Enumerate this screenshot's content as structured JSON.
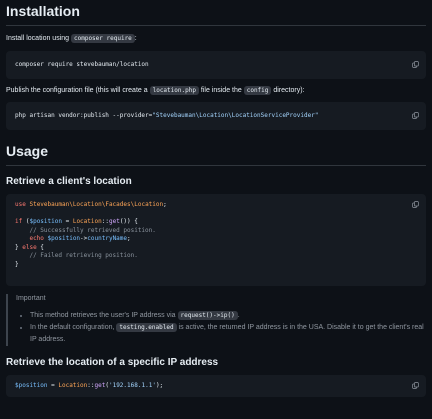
{
  "installation": {
    "heading": "Installation",
    "intro_prefix": "Install location using",
    "intro_code": "composer require",
    "intro_suffix": ":",
    "command": "composer require stevebauman/location",
    "publish_prefix": "Publish the configuration file (this will create a",
    "publish_file": "location.php",
    "publish_middle": "file inside the",
    "publish_dir": "config",
    "publish_suffix": "directory):",
    "publish_cmd_prefix": "php artisan vendor:publish --provider=",
    "publish_cmd_string": "\"Stevebauman\\Location\\LocationServiceProvider\""
  },
  "usage": {
    "heading": "Usage",
    "retrieve_heading": "Retrieve a client's location",
    "code": {
      "use_kw": "use",
      "use_class": "Stevebauman\\Location\\Facades\\Location",
      "use_end": ";",
      "if_kw": "if",
      "if_open": " (",
      "position_var": "$position",
      "assign": " = ",
      "location_class": "Location",
      "sep": "::",
      "get_fn": "get",
      "if_close": "()) {",
      "comment_success": "// Successfully retrieved position.",
      "echo_kw": "echo",
      "position_var2": "$position",
      "arrow": "->",
      "country_prop": "countryName",
      "echo_end": ";",
      "else_open": "} ",
      "else_kw": "else",
      "else_brace": " {",
      "comment_fail": "// Failed retrieving position.",
      "close_brace": "}"
    },
    "note": {
      "title": "Important",
      "item1_prefix": "This method retrieves the user's IP address via",
      "item1_code": "request()->ip()",
      "item1_suffix": ".",
      "item2_prefix": "In the default configuration,",
      "item2_code": "testing.enabled",
      "item2_suffix": "is active, the returned IP address is in the USA. Disable it to get the client's real IP address."
    },
    "specific_heading": "Retrieve the location of a specific IP address",
    "specific_code": {
      "var": "$position",
      "assign": " = ",
      "cls": "Location",
      "sep": "::",
      "fn": "get",
      "open": "(",
      "ip": "'192.168.1.1'",
      "close": ");"
    }
  },
  "icons": {
    "copy": "copy-icon"
  },
  "colors": {
    "background": "#0d1117",
    "code_bg": "#161b22",
    "keyword": "#ff7b72",
    "class": "#ffa657",
    "variable": "#79c0ff",
    "string": "#a5d6ff",
    "comment": "#8b949e"
  }
}
